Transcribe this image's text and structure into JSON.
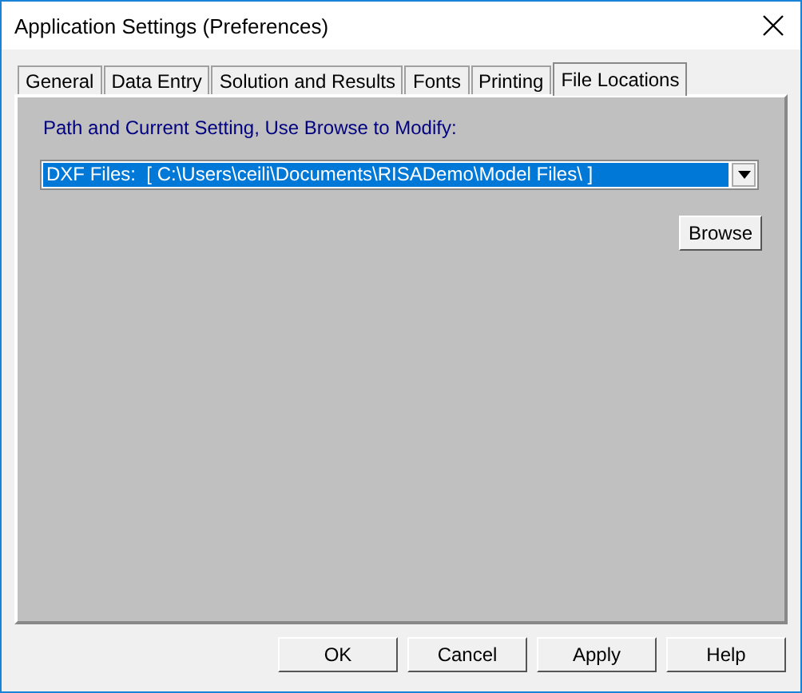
{
  "window": {
    "title": "Application Settings (Preferences)"
  },
  "tabs": [
    {
      "label": "General",
      "selected": false
    },
    {
      "label": "Data Entry",
      "selected": false
    },
    {
      "label": "Solution and Results",
      "selected": false
    },
    {
      "label": "Fonts",
      "selected": false
    },
    {
      "label": "Printing",
      "selected": false
    },
    {
      "label": "File Locations",
      "selected": true
    }
  ],
  "panel": {
    "label": "Path and Current Setting, Use Browse to Modify:",
    "dropdown": {
      "value": "DXF Files:  [ C:\\Users\\ceili\\Documents\\RISADemo\\Model Files\\ ]",
      "selected": true
    },
    "browse_button": "Browse"
  },
  "buttons": [
    "OK",
    "Cancel",
    "Apply",
    "Help"
  ]
}
